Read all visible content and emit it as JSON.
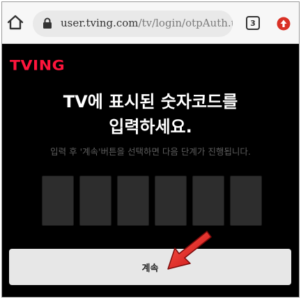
{
  "browser": {
    "url_host": "user.tving.com",
    "url_path": "/tv/login/otpAuth.tvi",
    "tab_count": "3",
    "icons": {
      "home": "home-icon",
      "lock": "lock-icon",
      "update": "update-arrow-icon"
    }
  },
  "page": {
    "logo": "TVING",
    "headline_line1": "TV에 표시된 숫자코드를",
    "headline_line2": "입력하세요.",
    "instruction": "입력 후 '계속'버튼을 선택하면 다음 단계가 진행됩니다.",
    "code_digits": [
      "",
      "",
      "",
      "",
      "",
      ""
    ],
    "continue_label": "계속"
  },
  "colors": {
    "brand_red": "#ff153c",
    "background": "#000000",
    "code_box": "#2d2d2d",
    "button": "#e7e7e7",
    "annotation_arrow": "#e4141b"
  }
}
